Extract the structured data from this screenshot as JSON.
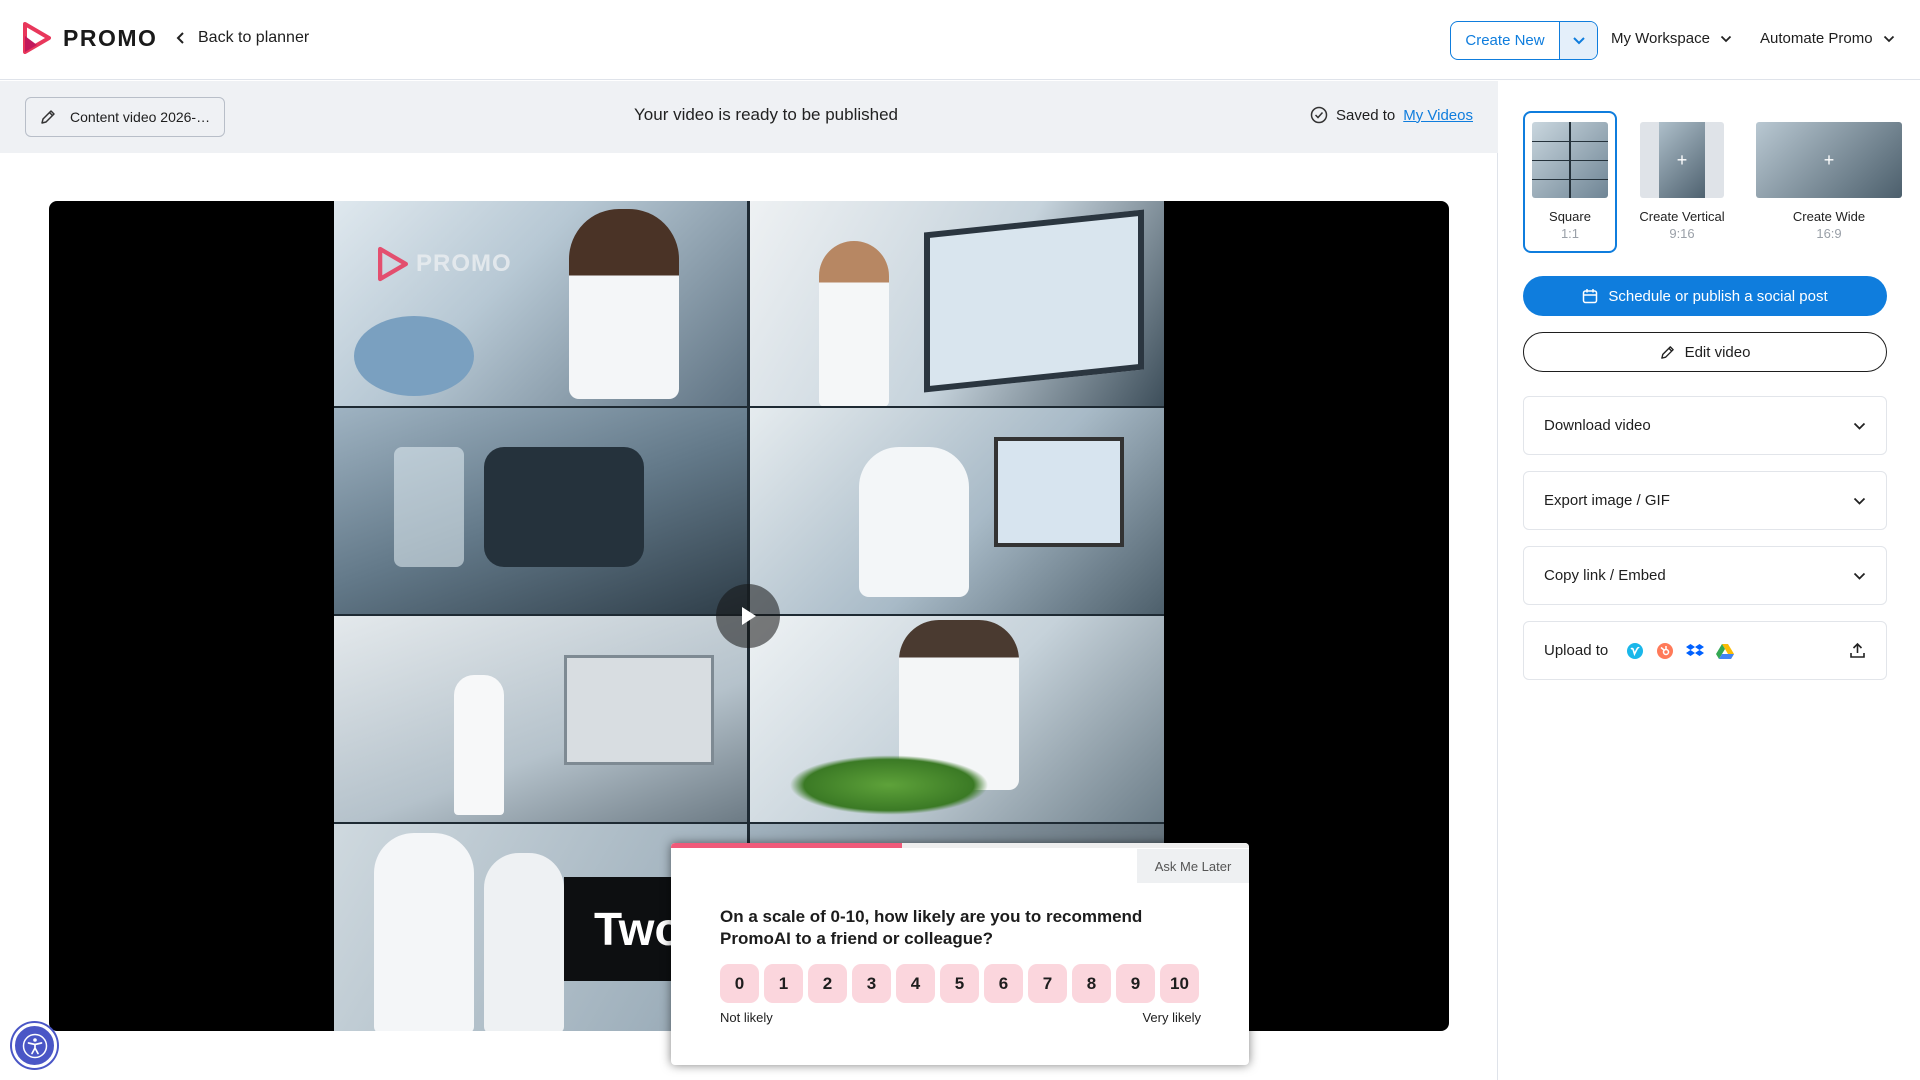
{
  "header": {
    "logo_text": "PROMO",
    "back_label": "Back to planner",
    "create_new_label": "Create New",
    "workspace_label": "My Workspace",
    "automate_label": "Automate Promo"
  },
  "toolbar": {
    "video_title": "Content video 2026-…",
    "status_text": "Your video is ready to be published",
    "saved_prefix": "Saved to",
    "saved_link": "My Videos"
  },
  "player": {
    "watermark": "PROMO",
    "caption_text": "Two"
  },
  "survey": {
    "progress": 0.4,
    "ask_later": "Ask Me Later",
    "question": "On a scale of 0-10, how likely are you to recommend PromoAI to a friend or colleague?",
    "scale": [
      "0",
      "1",
      "2",
      "3",
      "4",
      "5",
      "6",
      "7",
      "8",
      "9",
      "10"
    ],
    "low_label": "Not likely",
    "high_label": "Very likely"
  },
  "formats": [
    {
      "label": "Square",
      "ratio": "1:1",
      "selected": true
    },
    {
      "label": "Create Vertical",
      "ratio": "9:16",
      "selected": false
    },
    {
      "label": "Create Wide",
      "ratio": "16:9",
      "selected": false
    }
  ],
  "actions": {
    "schedule_label": "Schedule or publish a social post",
    "edit_label": "Edit video",
    "download_label": "Download video",
    "export_label": "Export image / GIF",
    "copy_label": "Copy link / Embed",
    "upload_label": "Upload to"
  },
  "upload_services": [
    "vimeo-icon",
    "hubspot-icon",
    "dropbox-icon",
    "google-drive-icon"
  ],
  "colors": {
    "accent": "#0f7ddd",
    "brand_pink": "#e8375b",
    "survey_progress": "#f05a7a",
    "scale_button": "#fbd6dd"
  }
}
